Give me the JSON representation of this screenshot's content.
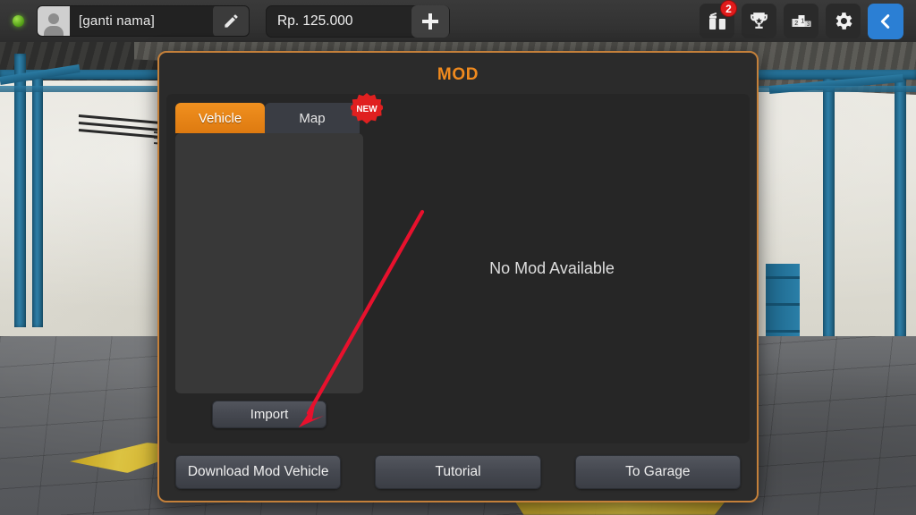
{
  "topbar": {
    "status_icon": "online-status-dot",
    "avatar_icon": "user-avatar-icon",
    "player_name": "[ganti nama]",
    "edit_icon": "pencil-edit-icon",
    "currency_value": "Rp. 125.000",
    "add_currency_icon": "plus-icon",
    "icons": [
      {
        "name": "gift-icon",
        "badge": "2"
      },
      {
        "name": "trophy-icon",
        "badge": ""
      },
      {
        "name": "leaderboard-podium-icon",
        "badge": ""
      },
      {
        "name": "gear-settings-icon",
        "badge": ""
      },
      {
        "name": "back-chevron-icon",
        "badge": ""
      }
    ],
    "podium_labels": {
      "second": "2",
      "first": "1",
      "third": "3"
    }
  },
  "dialog": {
    "title": "MOD",
    "tabs": [
      {
        "label": "Vehicle",
        "active": true
      },
      {
        "label": "Map",
        "active": false
      }
    ],
    "new_badge_label": "NEW",
    "import_label": "Import",
    "empty_state": "No Mod Available",
    "footer_buttons": [
      {
        "label": "Download Mod Vehicle"
      },
      {
        "label": "Tutorial"
      },
      {
        "label": "To Garage"
      }
    ]
  },
  "annotation": {
    "arrow_color": "#e8112d",
    "points_to": "Import"
  },
  "colors": {
    "accent_orange": "#f08a1e",
    "dialog_border": "#c4803a",
    "tab_active": "#ee8f1e",
    "badge_red": "#e01b1b",
    "back_button_blue": "#2b7fd4",
    "status_green": "#7ed321"
  }
}
